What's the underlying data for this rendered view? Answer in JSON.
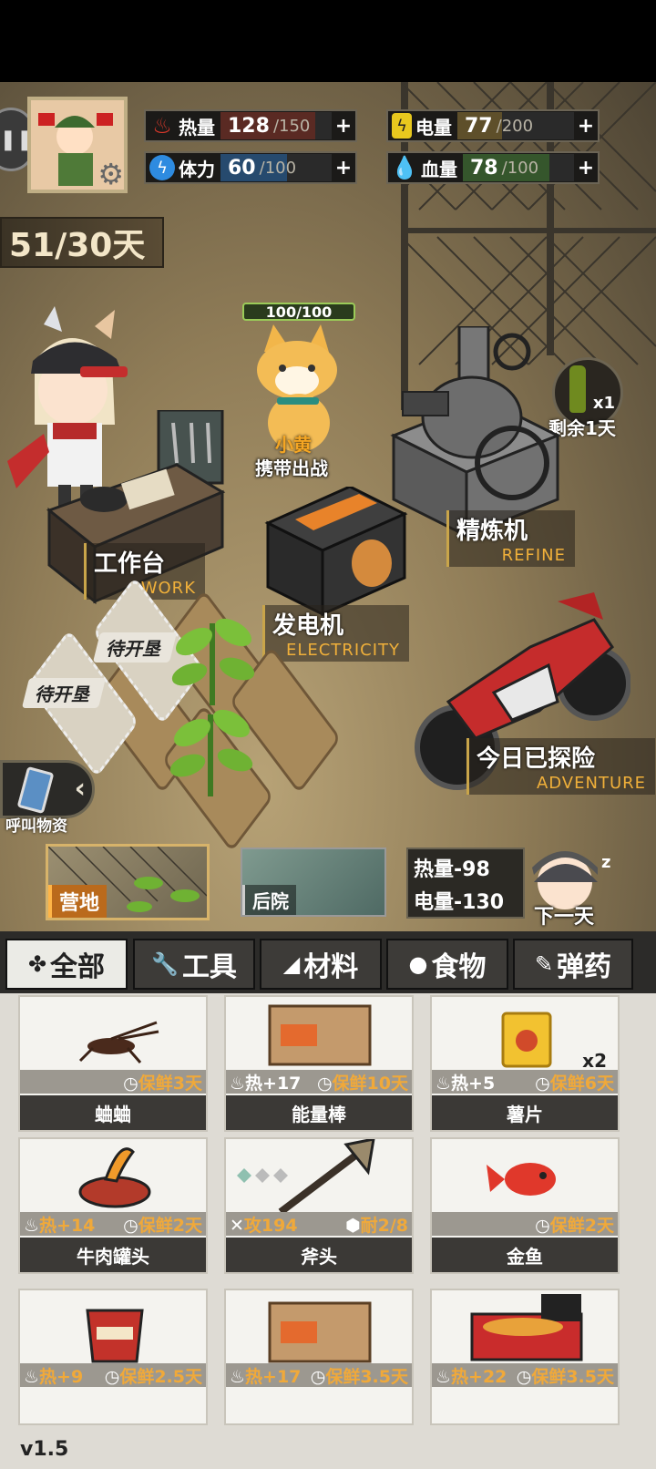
{
  "stats": [
    {
      "id": "heat",
      "label": "热量",
      "value": "128",
      "max": "/150",
      "plus": "+",
      "icon_name": "flame-icon",
      "color": "#e0392b",
      "fill_fraction": 0.853
    },
    {
      "id": "stamina",
      "label": "体力",
      "value": "60",
      "max": "/100",
      "plus": "+",
      "icon_name": "lightning-icon",
      "color": "#2e8be0",
      "fill_fraction": 0.6
    },
    {
      "id": "power",
      "label": "电量",
      "value": "77",
      "max": "/200",
      "plus": "+",
      "icon_name": "battery-icon",
      "color": "#e8c81e",
      "fill_fraction": 0.385
    },
    {
      "id": "health",
      "label": "血量",
      "value": "78",
      "max": "/100",
      "plus": "+",
      "icon_name": "blood-drop-icon",
      "color": "#3fb54f",
      "fill_fraction": 0.78
    }
  ],
  "day_counter": "51/30天",
  "pet": {
    "hp": "100/100",
    "name": "小黄",
    "action": "携带出战"
  },
  "consumable": {
    "qty": "x1",
    "remaining": "剩余1天"
  },
  "stations": {
    "workbench": {
      "cn": "工作台",
      "en": "WORK"
    },
    "generator": {
      "cn": "发电机",
      "en": "ELECTRICITY"
    },
    "refine": {
      "cn": "精炼机",
      "en": "REFINE"
    },
    "adventure": {
      "cn": "今日已探险",
      "en": "ADVENTURE"
    }
  },
  "plots": {
    "p1": "待开垦",
    "p2": "待开垦"
  },
  "call_supplies": "呼叫物资",
  "areas": {
    "camp": "营地",
    "backyard": "后院"
  },
  "next_day": {
    "heat_cost": "热量-98",
    "power_cost": "电量-130",
    "label": "下一天"
  },
  "tabs": [
    {
      "label": "全部",
      "icon": "◆"
    },
    {
      "label": "工具",
      "icon": "🔧"
    },
    {
      "label": "材料",
      "icon": "◢"
    },
    {
      "label": "食物",
      "icon": "●"
    },
    {
      "label": "弹药",
      "icon": "✎"
    }
  ],
  "items": [
    {
      "name": "蛐蛐",
      "left": "",
      "right": "保鲜3天",
      "qty": ""
    },
    {
      "name": "能量棒",
      "left": "热+17",
      "right": "保鲜10天",
      "qty": ""
    },
    {
      "name": "薯片",
      "left": "热+5",
      "right": "保鲜6天",
      "qty": "x2"
    },
    {
      "name": "牛肉罐头",
      "left": "热+14",
      "right": "保鲜2天",
      "qty": ""
    },
    {
      "name": "斧头",
      "left": "攻194",
      "right": "耐2/8",
      "qty": ""
    },
    {
      "name": "金鱼",
      "left": "",
      "right": "保鲜2天",
      "qty": ""
    },
    {
      "name": "",
      "left": "热+9",
      "right": "保鲜2.5天",
      "qty": ""
    },
    {
      "name": "",
      "left": "热+17",
      "right": "保鲜3.5天",
      "qty": ""
    },
    {
      "name": "",
      "left": "热+22",
      "right": "保鲜3.5天",
      "qty": ""
    }
  ],
  "version": "v1.5"
}
